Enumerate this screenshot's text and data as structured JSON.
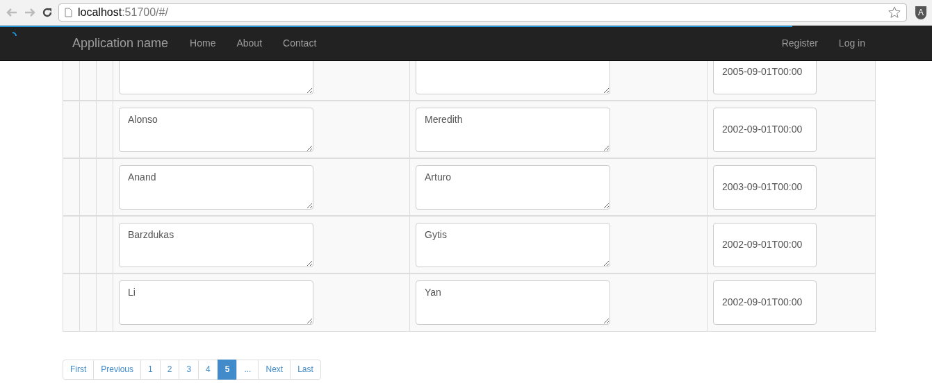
{
  "browser": {
    "url_host": "localhost",
    "url_rest": ":51700/#/",
    "extension_badge": "A"
  },
  "loading_bar": {
    "level": 0.85
  },
  "navbar": {
    "brand": "Application name",
    "links": [
      "Home",
      "About",
      "Contact"
    ],
    "right_links": [
      "Register",
      "Log in"
    ]
  },
  "table": {
    "rows": [
      {
        "date": "2005-09-01T00:00"
      },
      {
        "last_name": "Alonso",
        "first_name": "Meredith",
        "date": "2002-09-01T00:00"
      },
      {
        "last_name": "Anand",
        "first_name": "Arturo",
        "date": "2003-09-01T00:00"
      },
      {
        "last_name": "Barzdukas",
        "first_name": "Gytis",
        "date": "2002-09-01T00:00"
      },
      {
        "last_name": "Li",
        "first_name": "Yan",
        "date": "2002-09-01T00:00"
      }
    ]
  },
  "pagination": [
    {
      "label": "First",
      "selected": false
    },
    {
      "label": "Previous",
      "selected": false
    },
    {
      "label": "1",
      "selected": false
    },
    {
      "label": "2",
      "selected": false
    },
    {
      "label": "3",
      "selected": false
    },
    {
      "label": "4",
      "selected": false
    },
    {
      "label": "5",
      "selected": true
    },
    {
      "label": "...",
      "selected": false
    },
    {
      "label": "Next",
      "selected": false
    },
    {
      "label": "Last",
      "selected": false
    }
  ]
}
